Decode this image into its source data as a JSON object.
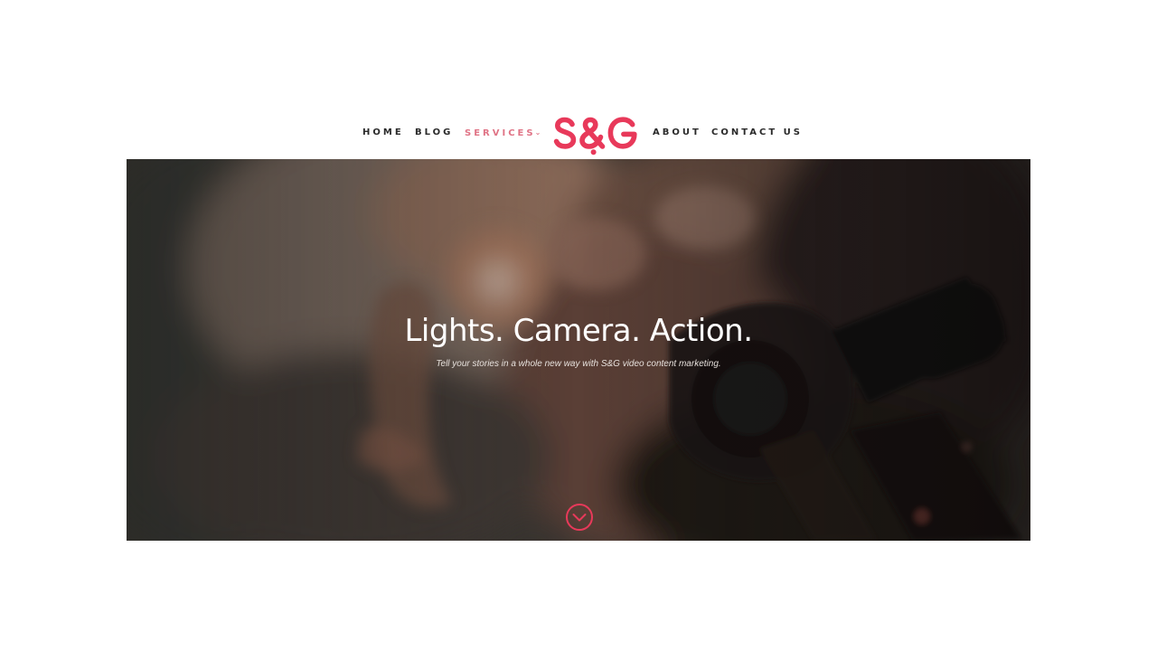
{
  "nav": {
    "items": [
      {
        "label": "HOME"
      },
      {
        "label": "BLOG"
      },
      {
        "label": "SERVICES",
        "active": true,
        "has_dropdown": true
      },
      {
        "label": "ABOUT"
      },
      {
        "label": "CONTACT US"
      }
    ],
    "logo_text": "S&G",
    "accent_color": "#e8395a",
    "active_color": "#e07486"
  },
  "hero": {
    "title": "Lights. Camera. Action.",
    "subtitle": "Tell your stories in a whole new way with S&G video content marketing.",
    "scroll_icon": "chevron-down-circle-icon"
  }
}
